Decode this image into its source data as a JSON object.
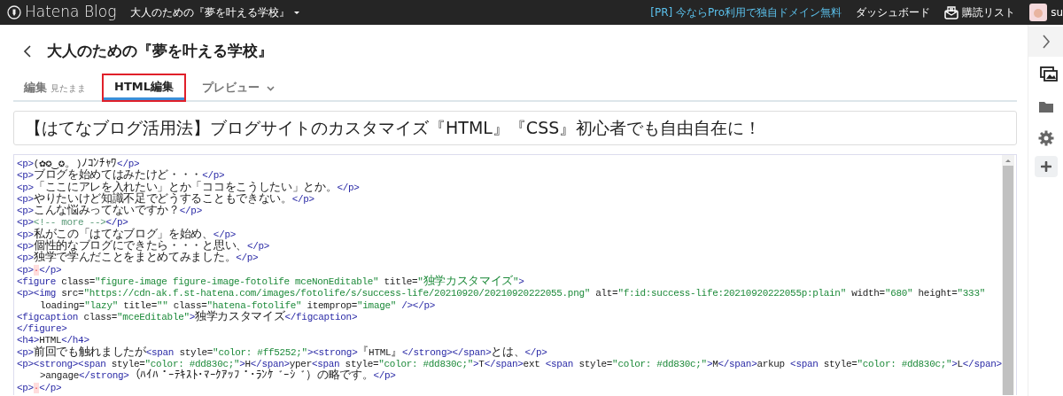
{
  "navbar": {
    "brand": "Hatena Blog",
    "blog_name": "大人のための『夢を叶える学校』",
    "promo": "[PR] 今ならPro利用で独自ドメイン無料",
    "dashboard": "ダッシュボード",
    "reading_list": "購読リスト",
    "user": "su"
  },
  "page": {
    "title": "大人のための『夢を叶える学校』"
  },
  "tabs": [
    {
      "label": "編集",
      "sub": "見たまま",
      "selected": false,
      "highlighted": false,
      "dropdown": false
    },
    {
      "label": "HTML編集",
      "selected": true,
      "highlighted": true,
      "dropdown": false
    },
    {
      "label": "プレビュー",
      "selected": false,
      "highlighted": false,
      "dropdown": true
    }
  ],
  "entry_title": "【はてなブログ活用法】ブログサイトのカスタマイズ『HTML』『CSS』初心者でも自由自在に！",
  "code_lines": [
    {
      "kind": "line",
      "text": "<p>(✿✪‿✪。)ﾉｺﾝﾁｬﾜ</p>"
    },
    {
      "kind": "line",
      "text": "<p>ブログを始めてはみたけど・・・</p>"
    },
    {
      "kind": "line",
      "text": "<p>「ここにアレを入れたい」とか「ココをこうしたい」とか。</p>"
    },
    {
      "kind": "line",
      "text": "<p>やりたいけど知識不足でどうすることもできない。</p>"
    },
    {
      "kind": "line",
      "text": "<p>こんな悩みってないですか？</p>"
    },
    {
      "kind": "line",
      "text": "<p><!-- more --></p>"
    },
    {
      "kind": "line",
      "text": "<p>私がこの「はてなブログ」を始め、</p>"
    },
    {
      "kind": "line",
      "text": "<p>個性的なブログにできたら・・・と思い、</p>"
    },
    {
      "kind": "line",
      "text": "<p>独学で学んだことをまとめてみました。</p>"
    },
    {
      "kind": "line",
      "text": "<p>·</p>"
    },
    {
      "kind": "line",
      "text": "<figure class=\"figure-image figure-image-fotolife mceNonEditable\" title=\"独学カスタマイズ\">"
    },
    {
      "kind": "line",
      "text": "<p><img src=\"https://cdn-ak.f.st-hatena.com/images/fotolife/s/success-life/20210920/20210920222055.png\" alt=\"f:id:success-life:20210920222055p:plain\" width=\"680\" height=\"333\""
    },
    {
      "kind": "wrapped",
      "text": "loading=\"lazy\" title=\"\" class=\"hatena-fotolife\" itemprop=\"image\" /></p>"
    },
    {
      "kind": "line",
      "text": "<figcaption class=\"mceEditable\">独学カスタマイズ</figcaption>"
    },
    {
      "kind": "line",
      "text": "</figure>"
    },
    {
      "kind": "line",
      "text": "<h4>HTML</h4>"
    },
    {
      "kind": "line",
      "text": "<p>前回でも触れましたが<span style=\"color: #ff5252;\"><strong>『HTML』</strong></span>とは、</p>"
    },
    {
      "kind": "line",
      "text": "<p><strong><span style=\"color: #dd830c;\">H</span>yper<span style=\"color: #dd830c;\">T</span>ext <span style=\"color: #dd830c;\">M</span>arkup <span style=\"color: #dd830c;\">L</span>"
    },
    {
      "kind": "wrapped",
      "text": ">angage</strong>（ﾊｲﾊﾟｰﾃｷｽﾄ･ﾏｰｸｱｯﾌﾟ･ﾗﾝｹﾞｰｼﾞ）の略です。</p>"
    },
    {
      "kind": "line",
      "text": "<p>·</p>"
    }
  ],
  "sidebar": [
    {
      "kind": "images",
      "selected": true
    },
    {
      "kind": "folder",
      "selected": false
    },
    {
      "kind": "gear",
      "selected": false
    },
    {
      "kind": "plus",
      "selected": false
    }
  ]
}
